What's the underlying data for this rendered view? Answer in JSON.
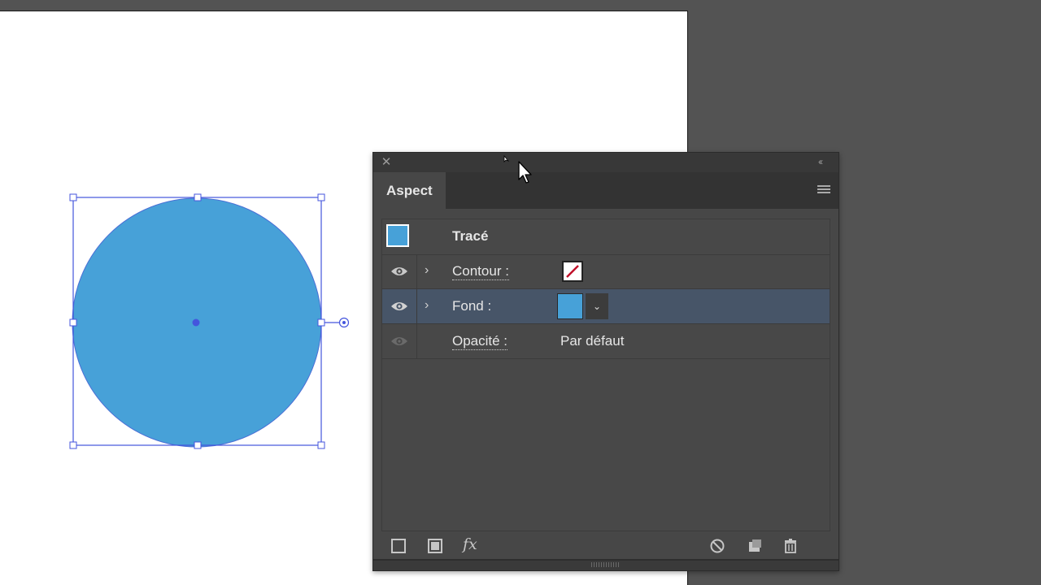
{
  "panel": {
    "tab_label": "Aspect"
  },
  "appearance": {
    "header_label": "Tracé",
    "contour_label": "Contour :",
    "fond_label": "Fond :",
    "opacite_label": "Opacité :",
    "opacite_value": "Par défaut"
  },
  "footer": {
    "fx_label": "fx"
  },
  "colors": {
    "fill": "#47a1d8",
    "selection": "#4455dd",
    "panel_bg": "#474747",
    "selected_row": "#475568"
  },
  "icons": {
    "close": "close-icon",
    "collapse": "double-chevron-left-icon",
    "menu": "hamburger-menu-icon",
    "eye": "eye-icon",
    "expand": "chevron-right-icon",
    "add_stroke": "add-stroke-icon",
    "add_fill": "add-fill-icon",
    "clear": "clear-appearance-icon",
    "duplicate": "duplicate-item-icon",
    "delete": "trash-icon"
  }
}
